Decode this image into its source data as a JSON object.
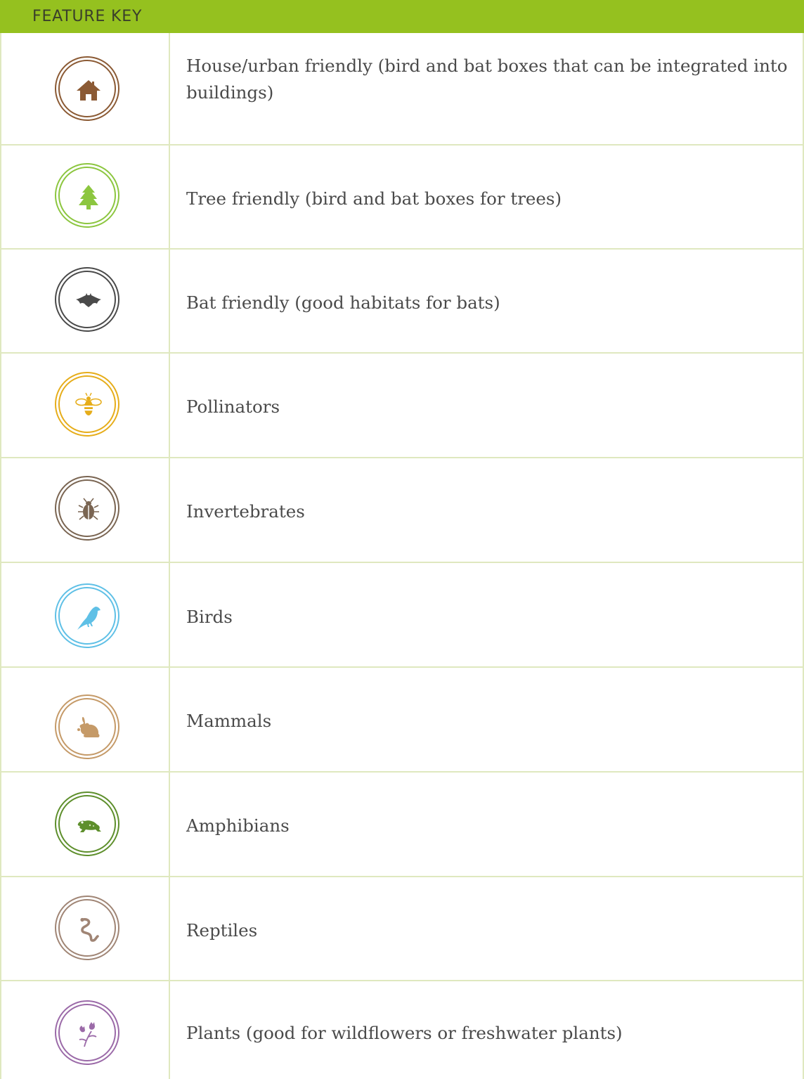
{
  "header": {
    "title": "FEATURE KEY"
  },
  "colors": {
    "header_bg": "#95c11f",
    "grid_line": "#dfe8bf"
  },
  "features": [
    {
      "icon": "house-icon",
      "color": "#8b5a34",
      "label": "House/urban friendly (bird and bat boxes that can be integrated into buildings)"
    },
    {
      "icon": "tree-icon",
      "color": "#8cc63f",
      "label": "Tree friendly (bird and bat boxes for trees)"
    },
    {
      "icon": "bat-icon",
      "color": "#4a4a4a",
      "label": "Bat friendly (good habitats for bats)"
    },
    {
      "icon": "bee-icon",
      "color": "#e6ad1a",
      "label": "Pollinators"
    },
    {
      "icon": "beetle-icon",
      "color": "#7a6552",
      "label": "Invertebrates"
    },
    {
      "icon": "bird-icon",
      "color": "#5fc0e6",
      "label": "Birds"
    },
    {
      "icon": "rabbit-icon",
      "color": "#c59a68",
      "label": "Mammals"
    },
    {
      "icon": "frog-icon",
      "color": "#5e8f2c",
      "label": "Amphibians"
    },
    {
      "icon": "snake-icon",
      "color": "#a08575",
      "label": "Reptiles"
    },
    {
      "icon": "flower-icon",
      "color": "#9b6aa8",
      "label": "Plants (good for wildflowers or freshwater plants)"
    }
  ]
}
